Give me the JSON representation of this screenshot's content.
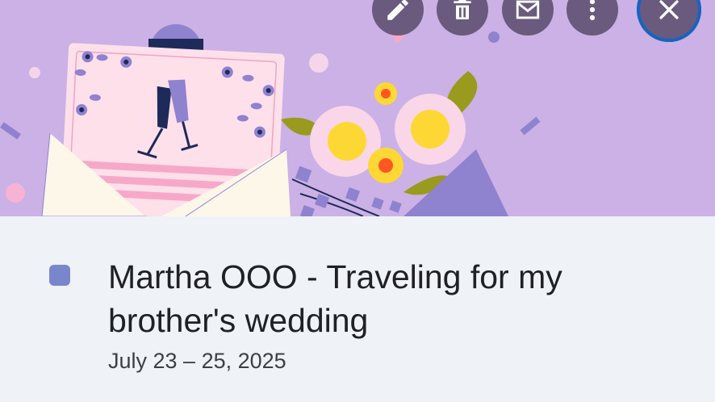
{
  "header": {
    "icons": {
      "edit": "pencil-icon",
      "delete": "trash-icon",
      "email": "mail-icon",
      "more": "more-vert-icon",
      "close": "close-icon"
    },
    "colors": {
      "hero_bg": "#cbb1e5",
      "button_bg": "#6a5a7e",
      "close_ring": "#1565c0"
    }
  },
  "event": {
    "title": "Martha OOO - Traveling for my brother's wedding",
    "date": "July 23 – 25, 2025",
    "calendar_color": "#7986cb"
  }
}
